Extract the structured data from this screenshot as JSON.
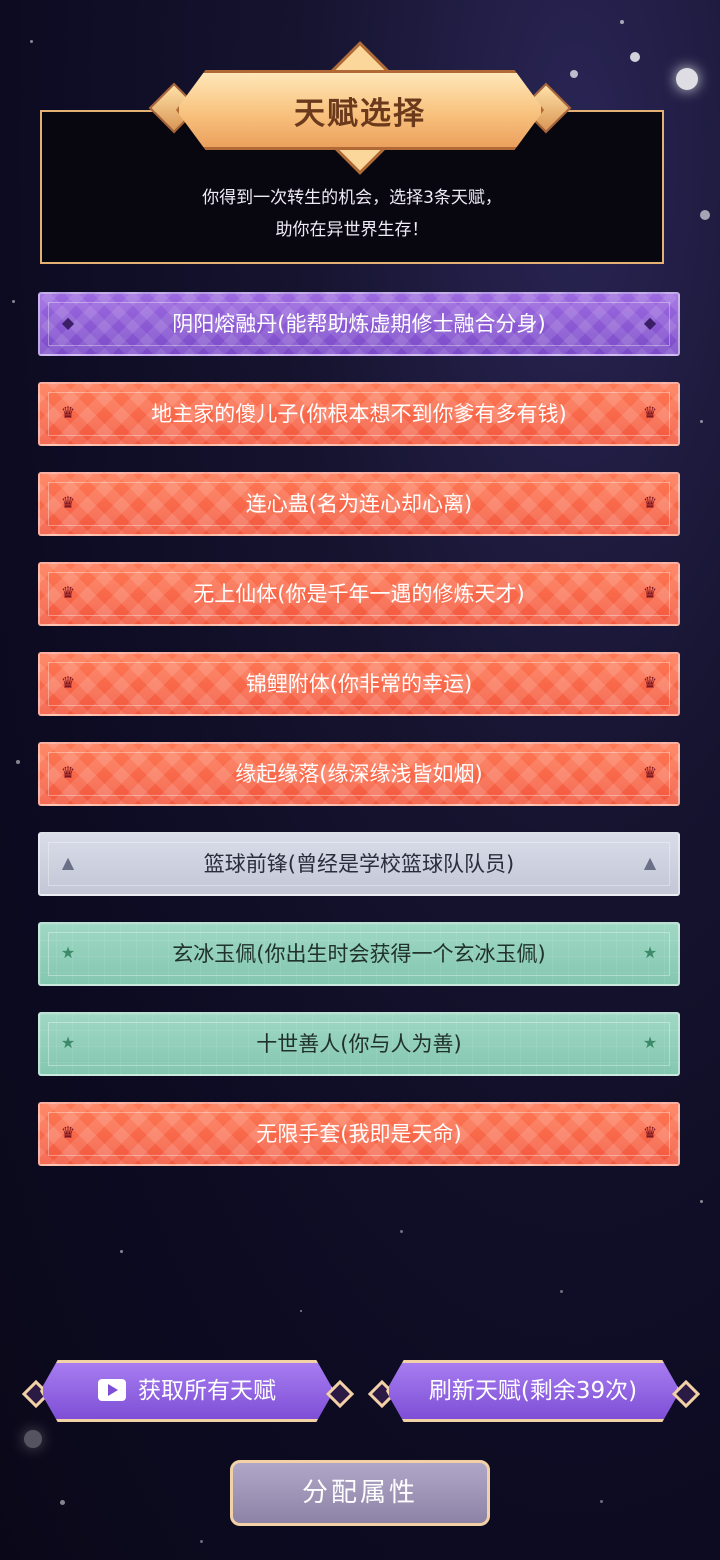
{
  "title": "天赋选择",
  "intro_line1": "你得到一次转生的机会，选择3条天赋，",
  "intro_line2": "助你在异世界生存！",
  "talents": [
    {
      "label": "阴阳熔融丹(能帮助炼虚期修士融合分身)",
      "rarity": "purple",
      "icon": "gem-icon"
    },
    {
      "label": "地主家的傻儿子(你根本想不到你爹有多有钱)",
      "rarity": "red",
      "icon": "crown-icon"
    },
    {
      "label": "连心蛊(名为连心却心离)",
      "rarity": "red",
      "icon": "crown-icon"
    },
    {
      "label": "无上仙体(你是千年一遇的修炼天才)",
      "rarity": "red",
      "icon": "crown-icon"
    },
    {
      "label": "锦鲤附体(你非常的幸运)",
      "rarity": "red",
      "icon": "crown-icon"
    },
    {
      "label": "缘起缘落(缘深缘浅皆如烟)",
      "rarity": "red",
      "icon": "crown-icon"
    },
    {
      "label": "篮球前锋(曾经是学校篮球队队员)",
      "rarity": "grey",
      "icon": "triangle-icon"
    },
    {
      "label": "玄冰玉佩(你出生时会获得一个玄冰玉佩)",
      "rarity": "green",
      "icon": "star-icon"
    },
    {
      "label": "十世善人(你与人为善)",
      "rarity": "green",
      "icon": "star-icon"
    },
    {
      "label": "无限手套(我即是天命)",
      "rarity": "red",
      "icon": "crown-icon"
    }
  ],
  "buttons": {
    "get_all": "获取所有天赋",
    "refresh": "刷新天赋(剩余39次)",
    "allocate": "分配属性"
  },
  "colors": {
    "purple": "#8a5ad4",
    "red": "#f5603f",
    "grey": "#cdd0de",
    "green": "#8fcfb9",
    "gold": "#f2d1a6"
  }
}
